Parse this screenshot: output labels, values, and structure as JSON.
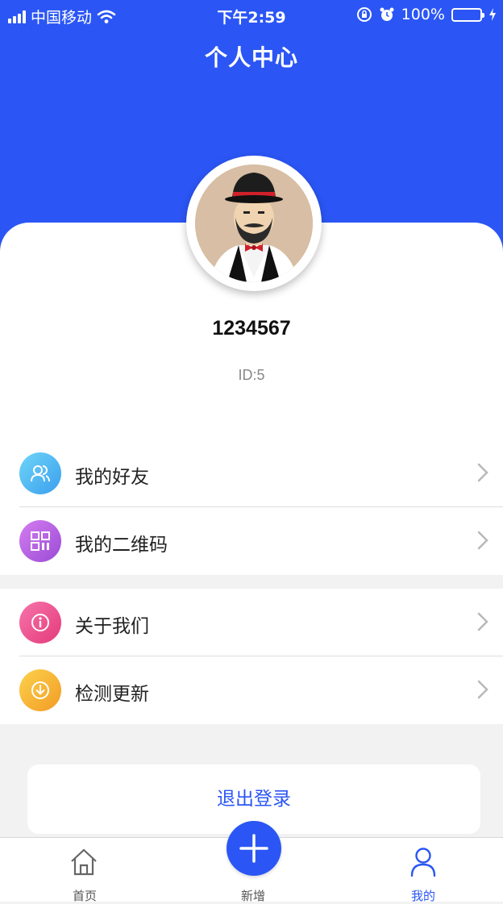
{
  "status_bar": {
    "carrier": "中国移动",
    "time": "下午2:59",
    "battery": "100%"
  },
  "header": {
    "title": "个人中心"
  },
  "profile": {
    "username": "1234567",
    "id_text": "ID:5"
  },
  "menu": {
    "friends": {
      "label": "我的好友",
      "icon": "friends-icon"
    },
    "qrcode": {
      "label": "我的二维码",
      "icon": "qrcode-icon"
    },
    "about": {
      "label": "关于我们",
      "icon": "info-icon"
    },
    "update": {
      "label": "检测更新",
      "icon": "download-icon"
    }
  },
  "logout": {
    "label": "退出登录"
  },
  "tabbar": {
    "home": "首页",
    "add": "新增",
    "mine": "我的"
  },
  "colors": {
    "primary": "#2b56f5",
    "friends_icon": "#4ab8f0",
    "qrcode_icon": "#b65ee0",
    "about_icon": "#ee4d8c",
    "update_icon": "#f6b536"
  }
}
